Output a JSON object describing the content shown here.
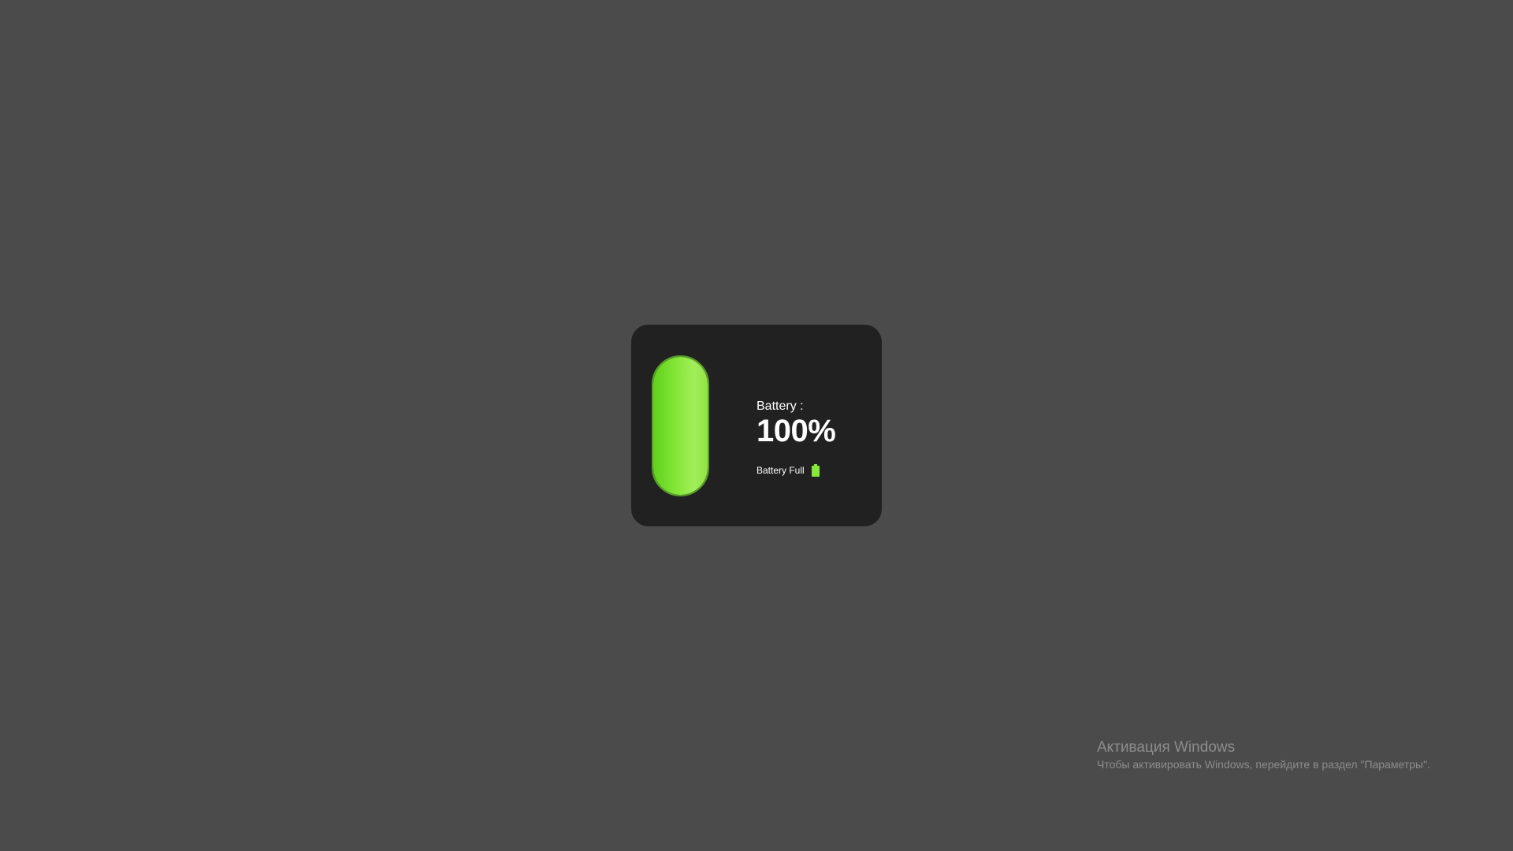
{
  "battery": {
    "label": "Battery :",
    "percent_text": "100%",
    "level": 1.0,
    "status_text": "Battery Full",
    "status_icon": "battery-full-icon",
    "accent_color": "#86e83a"
  },
  "watermark": {
    "title": "Активация Windows",
    "subtitle": "Чтобы активировать Windows, перейдите в раздел \"Параметры\"."
  }
}
